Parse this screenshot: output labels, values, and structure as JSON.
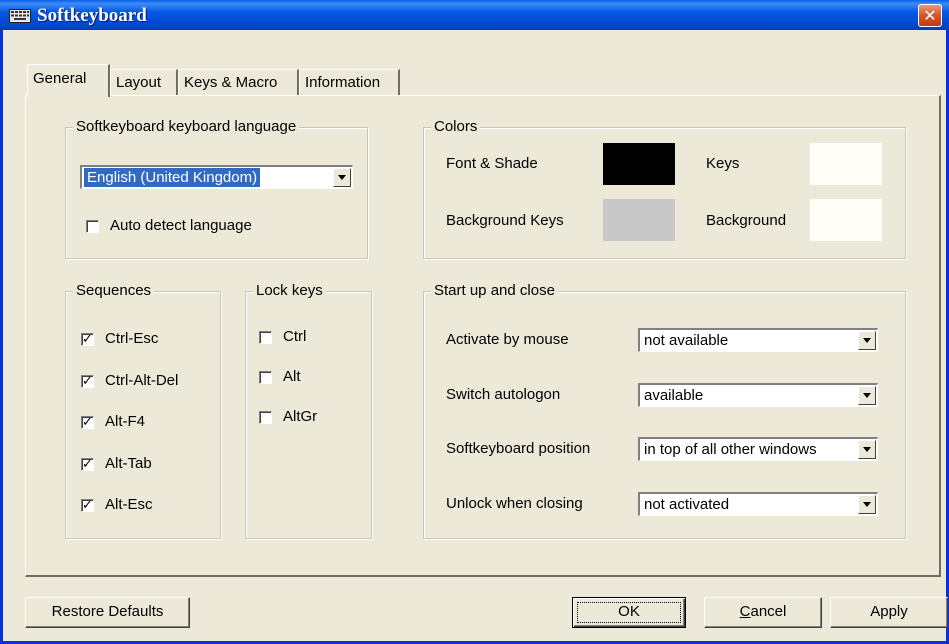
{
  "window": {
    "title": "Softkeyboard",
    "close_glyph": "✕"
  },
  "tabs": [
    "General",
    "Layout",
    "Keys & Macro",
    "Information"
  ],
  "language_group": {
    "title": "Softkeyboard keyboard language",
    "selected_language": "English (United Kingdom)",
    "auto_detect_label": "Auto detect language",
    "auto_detect_checked": false
  },
  "colors_group": {
    "title": "Colors",
    "font_shade_label": "Font & Shade",
    "background_keys_label": "Background Keys",
    "keys_label": "Keys",
    "background_label": "Background",
    "font_shade_color": "#000000",
    "background_keys_color": "#c8c8c8",
    "keys_color": "#fffff8",
    "background_color": "#fffff8"
  },
  "sequences_group": {
    "title": "Sequences",
    "items": [
      {
        "label": "Ctrl-Esc",
        "checked": true
      },
      {
        "label": "Ctrl-Alt-Del",
        "checked": true
      },
      {
        "label": "Alt-F4",
        "checked": true
      },
      {
        "label": "Alt-Tab",
        "checked": true
      },
      {
        "label": "Alt-Esc",
        "checked": true
      }
    ]
  },
  "lock_keys_group": {
    "title": "Lock keys",
    "items": [
      {
        "label": "Ctrl",
        "checked": false
      },
      {
        "label": "Alt",
        "checked": false
      },
      {
        "label": "AltGr",
        "checked": false
      }
    ]
  },
  "startup_group": {
    "title": "Start up and close",
    "rows": [
      {
        "label": "Activate by mouse",
        "value": "not available"
      },
      {
        "label": "Switch autologon",
        "value": "available"
      },
      {
        "label": "Softkeyboard position",
        "value": "in top of all other windows"
      },
      {
        "label": "Unlock when closing",
        "value": "not activated"
      }
    ]
  },
  "buttons": {
    "restore_defaults": "Restore Defaults",
    "ok": "OK",
    "cancel_first": "C",
    "cancel_rest": "ancel",
    "apply": "Apply"
  },
  "check_glyph": "✓"
}
